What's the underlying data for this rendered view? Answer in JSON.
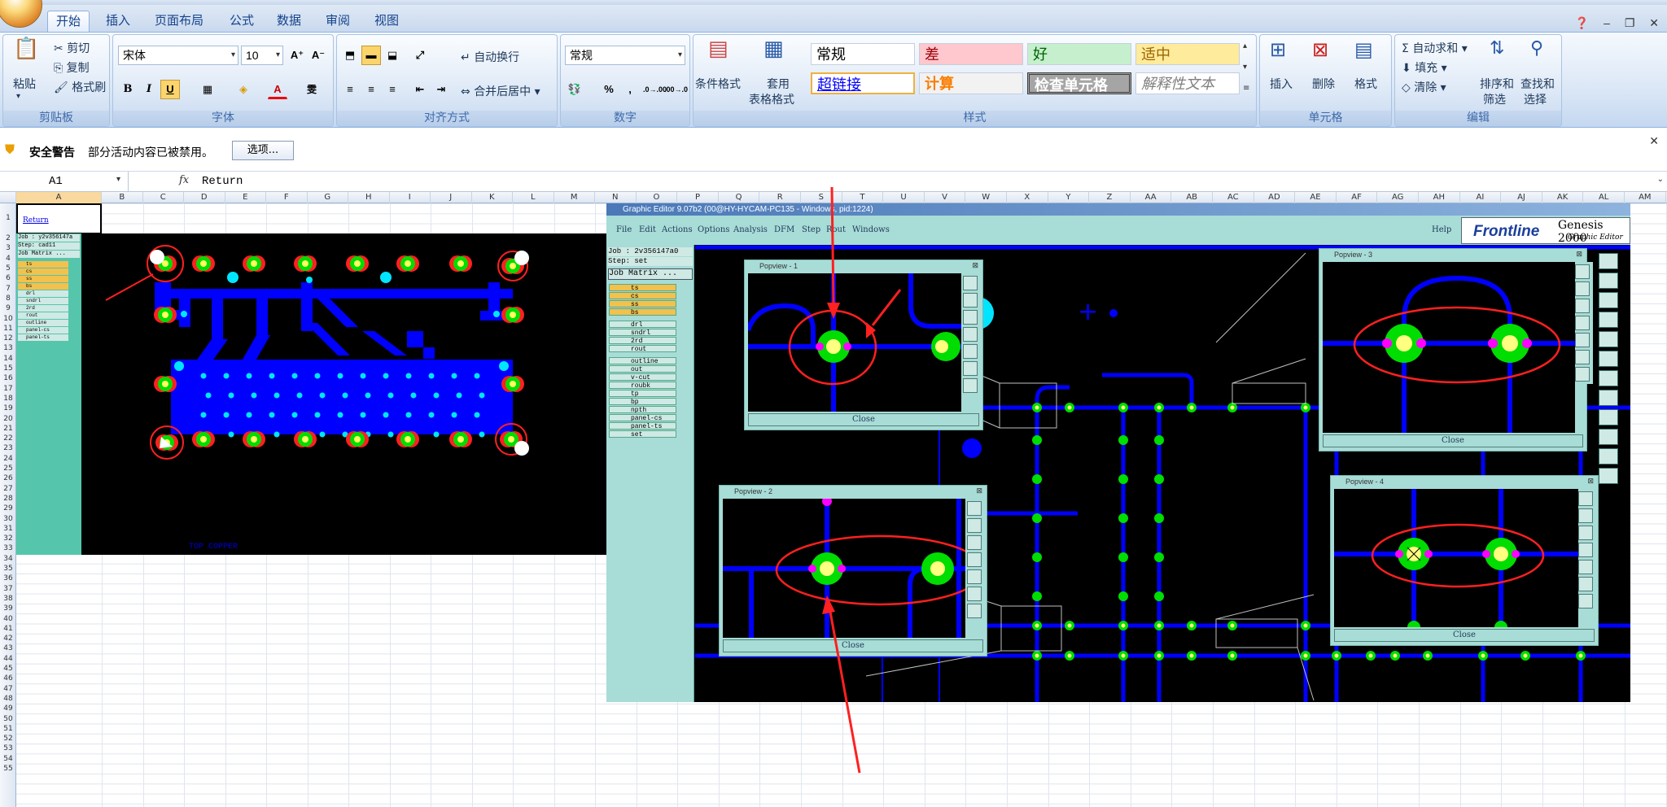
{
  "ribbon": {
    "tabs": [
      "开始",
      "插入",
      "页面布局",
      "公式",
      "数据",
      "审阅",
      "视图"
    ],
    "clipboard": {
      "paste": "粘贴",
      "cut": "剪切",
      "copy": "复制",
      "format_painter": "格式刷",
      "label": "剪贴板"
    },
    "font": {
      "name": "宋体",
      "size": "10",
      "label": "字体",
      "bold": "B",
      "italic": "I",
      "underline": "U"
    },
    "alignment": {
      "wrap": "自动换行",
      "merge": "合并后居中",
      "label": "对齐方式"
    },
    "number": {
      "format": "常规",
      "percent": "%",
      "comma": ",",
      "label": "数字"
    },
    "styles": {
      "conditional": "条件格式",
      "table_format_1": "套用",
      "table_format_2": "表格格式",
      "cells": [
        "常规",
        "差",
        "好",
        "适中",
        "超链接",
        "计算",
        "检查单元格",
        "解释性文本"
      ],
      "label": "样式"
    },
    "cells_group": {
      "insert": "插入",
      "delete": "删除",
      "format": "格式",
      "label": "单元格"
    },
    "editing": {
      "autosum": "自动求和",
      "fill": "填充",
      "clear": "清除",
      "sort_1": "排序和",
      "sort_2": "筛选",
      "find_1": "查找和",
      "find_2": "选择",
      "label": "编辑"
    }
  },
  "security": {
    "title": "安全警告",
    "message": "部分活动内容已被禁用。",
    "options_button": "选项..."
  },
  "formula_bar": {
    "cell_ref": "A1",
    "fx": "fx",
    "content": "Return"
  },
  "columns": [
    "A",
    "B",
    "C",
    "D",
    "E",
    "F",
    "G",
    "H",
    "I",
    "J",
    "K",
    "L",
    "M",
    "N",
    "O",
    "P",
    "Q",
    "R",
    "S",
    "T",
    "U",
    "V",
    "W",
    "X",
    "Y",
    "Z",
    "AA",
    "AB",
    "AC",
    "AD",
    "AE",
    "AF",
    "AG",
    "AH",
    "AI",
    "AJ",
    "AK",
    "AL",
    "AM"
  ],
  "rows": [
    "1",
    "2",
    "3",
    "4",
    "5",
    "6",
    "7",
    "8",
    "9",
    "10",
    "11",
    "12",
    "13",
    "14",
    "15",
    "16",
    "17",
    "18",
    "19",
    "20",
    "21",
    "22",
    "23",
    "24",
    "25",
    "26",
    "27",
    "28",
    "29",
    "30",
    "31",
    "32",
    "33",
    "34",
    "35",
    "36",
    "37",
    "38",
    "39",
    "40",
    "41",
    "42",
    "43",
    "44",
    "45",
    "46",
    "47",
    "48",
    "49",
    "50",
    "51",
    "52",
    "53",
    "54",
    "55"
  ],
  "sheet": {
    "a1_link": "Return",
    "top_copper_label": "TOP COPPER"
  },
  "left_panel": {
    "job": "Job : y2v356147a",
    "step": "Step: cad11",
    "matrix": "Job Matrix ...",
    "layers": [
      "ts",
      "cs",
      "ss",
      "bs",
      "drl",
      "sndrl",
      "2rd",
      "rout",
      "outline",
      "panel-cs",
      "panel-ts"
    ]
  },
  "graphic_editor": {
    "title": "Graphic Editor 9.07b2 (00@HY-HYCAM-PC135 - Windows, pid:1224)",
    "menu": [
      "File",
      "Edit",
      "Actions",
      "Options",
      "Analysis",
      "DFM",
      "Step",
      "Rout",
      "Windows"
    ],
    "help": "Help",
    "brand": "Frontline",
    "product": "Genesis 2000",
    "product_sub": "Graphic Editor",
    "job": "Job : 2v356147a0",
    "step": "Step: set",
    "matrix": "Job Matrix ...",
    "layers": [
      "ts",
      "cs",
      "ss",
      "bs",
      "drl",
      "sndrl",
      "2rd",
      "rout",
      "outline",
      "out",
      "v-cut",
      "roubk",
      "tp",
      "bp",
      "npth",
      "panel-cs",
      "panel-ts",
      "set"
    ]
  },
  "popviews": [
    {
      "title": "Popview - 1",
      "close": "Close"
    },
    {
      "title": "Popview - 2",
      "close": "Close"
    },
    {
      "title": "Popview - 3",
      "close": "Close"
    },
    {
      "title": "Popview - 4",
      "close": "Close"
    }
  ]
}
